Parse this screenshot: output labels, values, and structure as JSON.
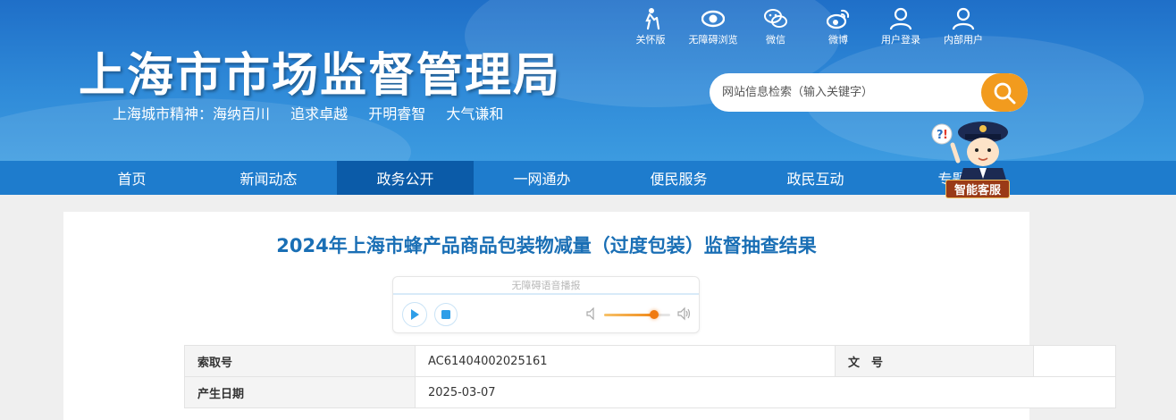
{
  "header": {
    "site_title": "上海市市场监督管理局",
    "slogan": [
      "上海城市精神：海纳百川",
      "追求卓越",
      "开明睿智",
      "大气谦和"
    ],
    "top_links": [
      {
        "label": "关怀版",
        "icon": "elderly-care-icon"
      },
      {
        "label": "无障碍浏览",
        "icon": "eye-icon"
      },
      {
        "label": "微信",
        "icon": "wechat-icon"
      },
      {
        "label": "微博",
        "icon": "weibo-icon"
      },
      {
        "label": "用户登录",
        "icon": "user-icon"
      },
      {
        "label": "内部用户",
        "icon": "user-icon"
      }
    ],
    "search": {
      "placeholder": "网站信息检索（输入关键字）"
    }
  },
  "nav": {
    "items": [
      "首页",
      "新闻动态",
      "政务公开",
      "一网通办",
      "便民服务",
      "政民互动",
      "专题"
    ],
    "active": "政务公开"
  },
  "assistant": {
    "label": "智能客服"
  },
  "article": {
    "title": "2024年上海市蜂产品商品包装物减量（过度包装）监督抽查结果"
  },
  "audio_player": {
    "label": "无障碍语音播报",
    "volume": 0.75
  },
  "info_table": {
    "rows": [
      {
        "key": "索取号",
        "value": "AC61404002025161",
        "key2": "文　号",
        "value2": ""
      },
      {
        "key": "产生日期",
        "value": "2025-03-07"
      }
    ]
  },
  "colors": {
    "header_blue": "#2f8ad8",
    "nav_blue": "#1e7ccd",
    "nav_active": "#0b5ba8",
    "title_blue": "#1a6fb5",
    "search_orange": "#f29b1e"
  }
}
